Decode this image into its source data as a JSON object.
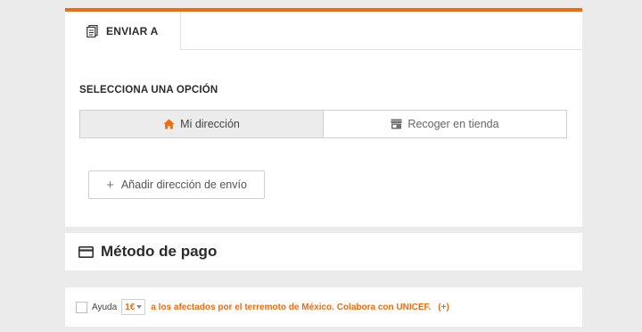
{
  "shipping": {
    "tab_label": "ENVIAR A",
    "section_label": "SELECCIONA UNA OPCIÓN",
    "options": [
      {
        "label": "Mi dirección",
        "icon": "home-icon",
        "selected": true
      },
      {
        "label": "Recoger en tienda",
        "icon": "store-icon",
        "selected": false
      }
    ],
    "add_address_label": "Añadir dirección de envío"
  },
  "payment": {
    "title": "Método de pago",
    "icon": "credit-card-icon"
  },
  "donation": {
    "label": "Ayuda",
    "amount": "1€",
    "message": "a los afectados por el terremoto de México. Colabora con UNICEF.",
    "more_link": "(+)"
  },
  "colors": {
    "accent": "#f06a0f",
    "background": "#ebebeb"
  }
}
